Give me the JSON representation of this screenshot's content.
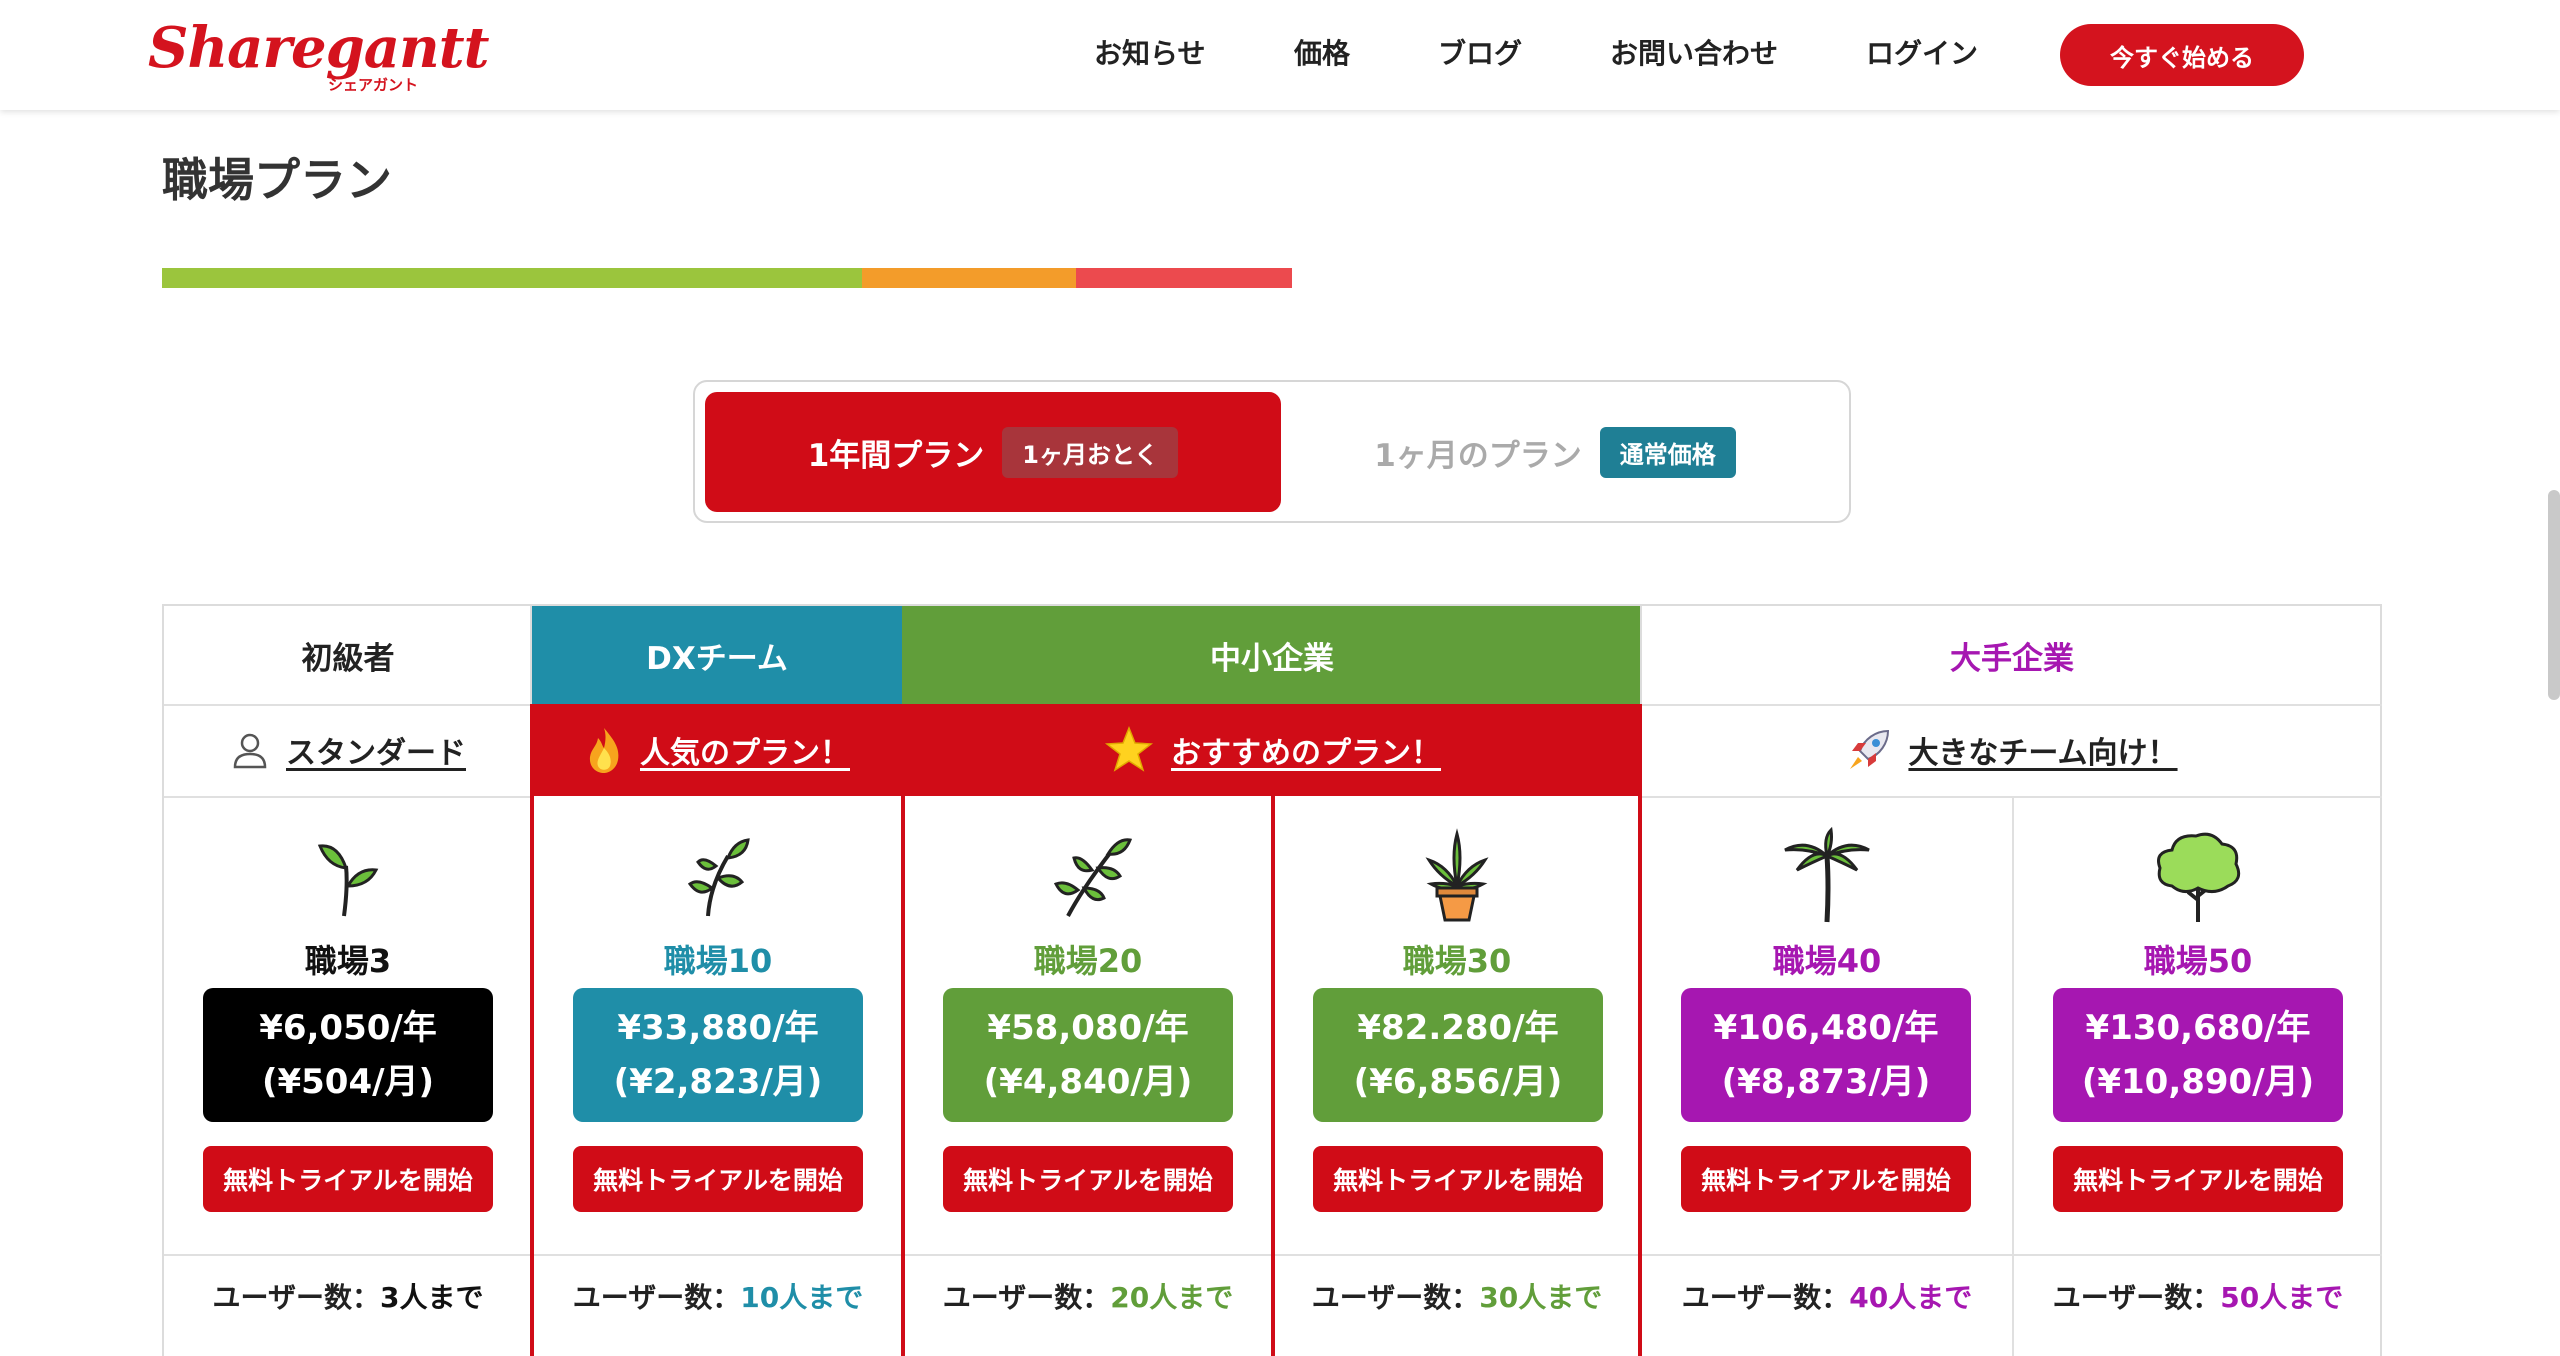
{
  "header": {
    "logo_main": "Sharegantt",
    "logo_sub": "シェアガント",
    "nav": [
      "お知らせ",
      "価格",
      "ブログ",
      "お問い合わせ",
      "ログイン"
    ],
    "cta": "今すぐ始める"
  },
  "title": "職場プラン",
  "colors": {
    "brand_red": "#d00c17",
    "teal": "#1f8ea8",
    "green": "#619e3a",
    "purple": "#a617b1",
    "bar_green": "#9bc53d",
    "bar_orange": "#f39c2a",
    "bar_red": "#ec4a4e"
  },
  "toggle": {
    "yearly_label": "1年間プラン",
    "yearly_badge": "1ヶ月おとく",
    "monthly_label": "1ヶ月のプラン",
    "monthly_badge": "通常価格"
  },
  "categories": {
    "beginner": "初級者",
    "dx": "DXチーム",
    "sme": "中小企業",
    "enterprise": "大手企業"
  },
  "subheads": {
    "standard": "スタンダード",
    "popular": "人気のプラン！",
    "recommended": "おすすめのプラン！",
    "big_team": "大きなチーム向け！"
  },
  "plans": [
    {
      "name": "職場3",
      "price_year": "¥6,050/年",
      "price_month": "(¥504/月)",
      "button": "無料トライアルを開始",
      "users_label": "ユーザー数：",
      "users_value": "3人まで",
      "icon": "sprout-icon"
    },
    {
      "name": "職場10",
      "price_year": "¥33,880/年",
      "price_month": "(¥2,823/月)",
      "button": "無料トライアルを開始",
      "users_label": "ユーザー数：",
      "users_value": "10人まで",
      "icon": "seedling-icon"
    },
    {
      "name": "職場20",
      "price_year": "¥58,080/年",
      "price_month": "(¥4,840/月)",
      "button": "無料トライアルを開始",
      "users_label": "ユーザー数：",
      "users_value": "20人まで",
      "icon": "branch-icon"
    },
    {
      "name": "職場30",
      "price_year": "¥82.280/年",
      "price_month": "(¥6,856/月)",
      "button": "無料トライアルを開始",
      "users_label": "ユーザー数：",
      "users_value": "30人まで",
      "icon": "potted-plant-icon"
    },
    {
      "name": "職場40",
      "price_year": "¥106,480/年",
      "price_month": "(¥8,873/月)",
      "button": "無料トライアルを開始",
      "users_label": "ユーザー数：",
      "users_value": "40人まで",
      "icon": "palm-tree-icon"
    },
    {
      "name": "職場50",
      "price_year": "¥130,680/年",
      "price_month": "(¥10,890/月)",
      "button": "無料トライアルを開始",
      "users_label": "ユーザー数：",
      "users_value": "50人まで",
      "icon": "tree-icon"
    }
  ]
}
